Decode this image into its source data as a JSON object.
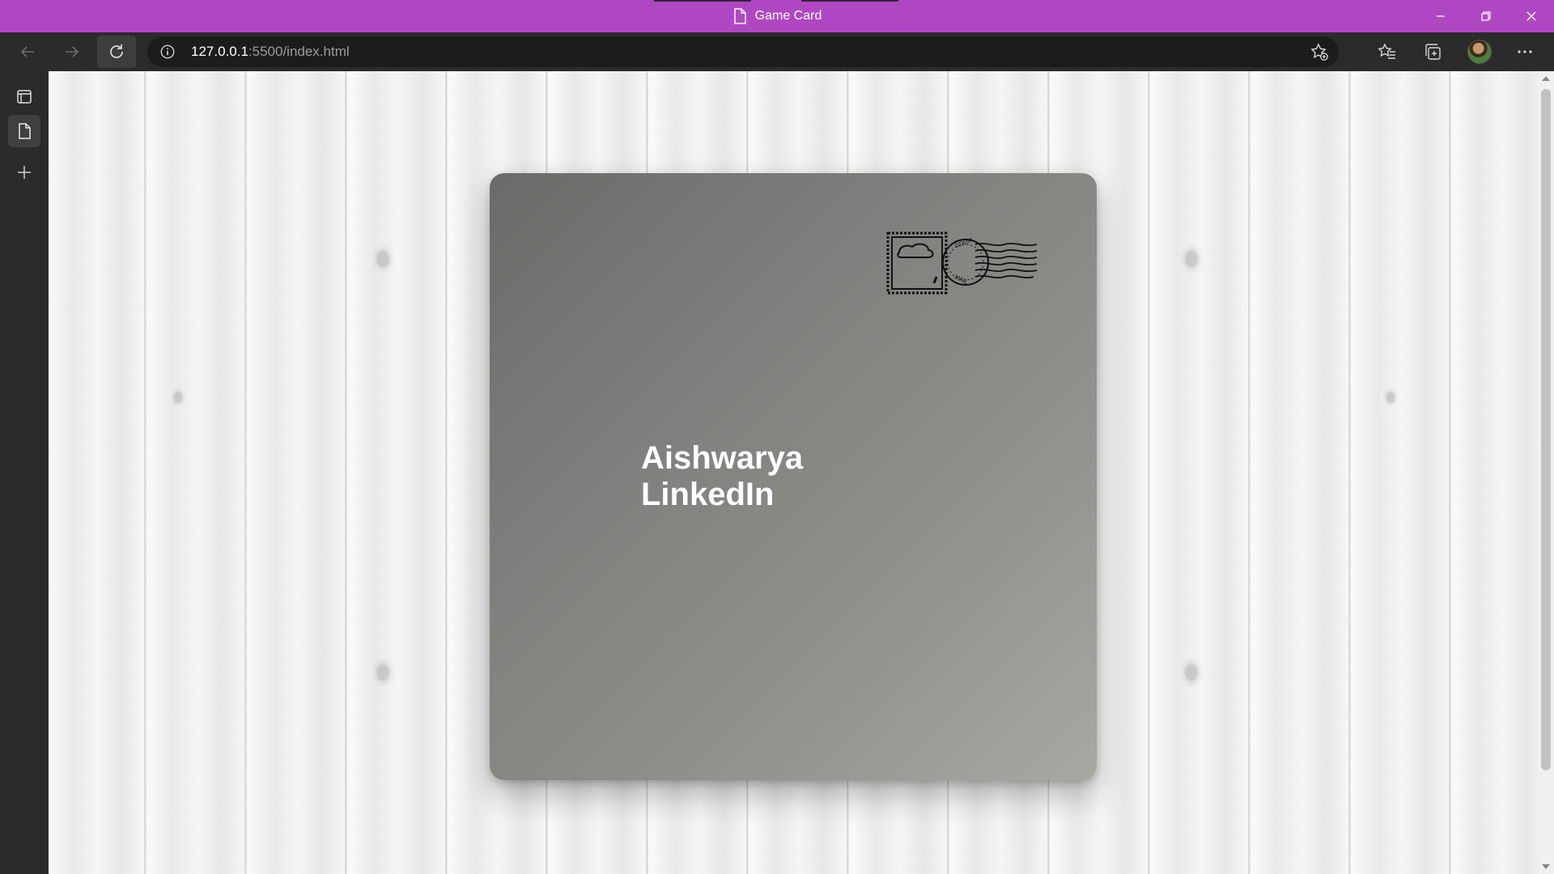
{
  "window": {
    "title": "Game Card",
    "accent_color": "#b047c2"
  },
  "address_bar": {
    "url_host": "127.0.0.1",
    "url_rest": ":5500/index.html"
  },
  "icons": {
    "page": "document-icon",
    "back": "back-arrow-icon",
    "forward": "forward-arrow-icon",
    "refresh": "refresh-icon",
    "info": "info-icon",
    "add_favorite": "star-plus-icon",
    "favorites": "favorites-icon",
    "collections": "collections-icon",
    "profile": "avatar",
    "more": "more-icon",
    "tab_actions": "tab-actions-icon",
    "vertical_tab": "document-icon",
    "new_tab": "plus-icon"
  },
  "card": {
    "line1": "Aishwarya",
    "line2": "LinkedIn"
  }
}
